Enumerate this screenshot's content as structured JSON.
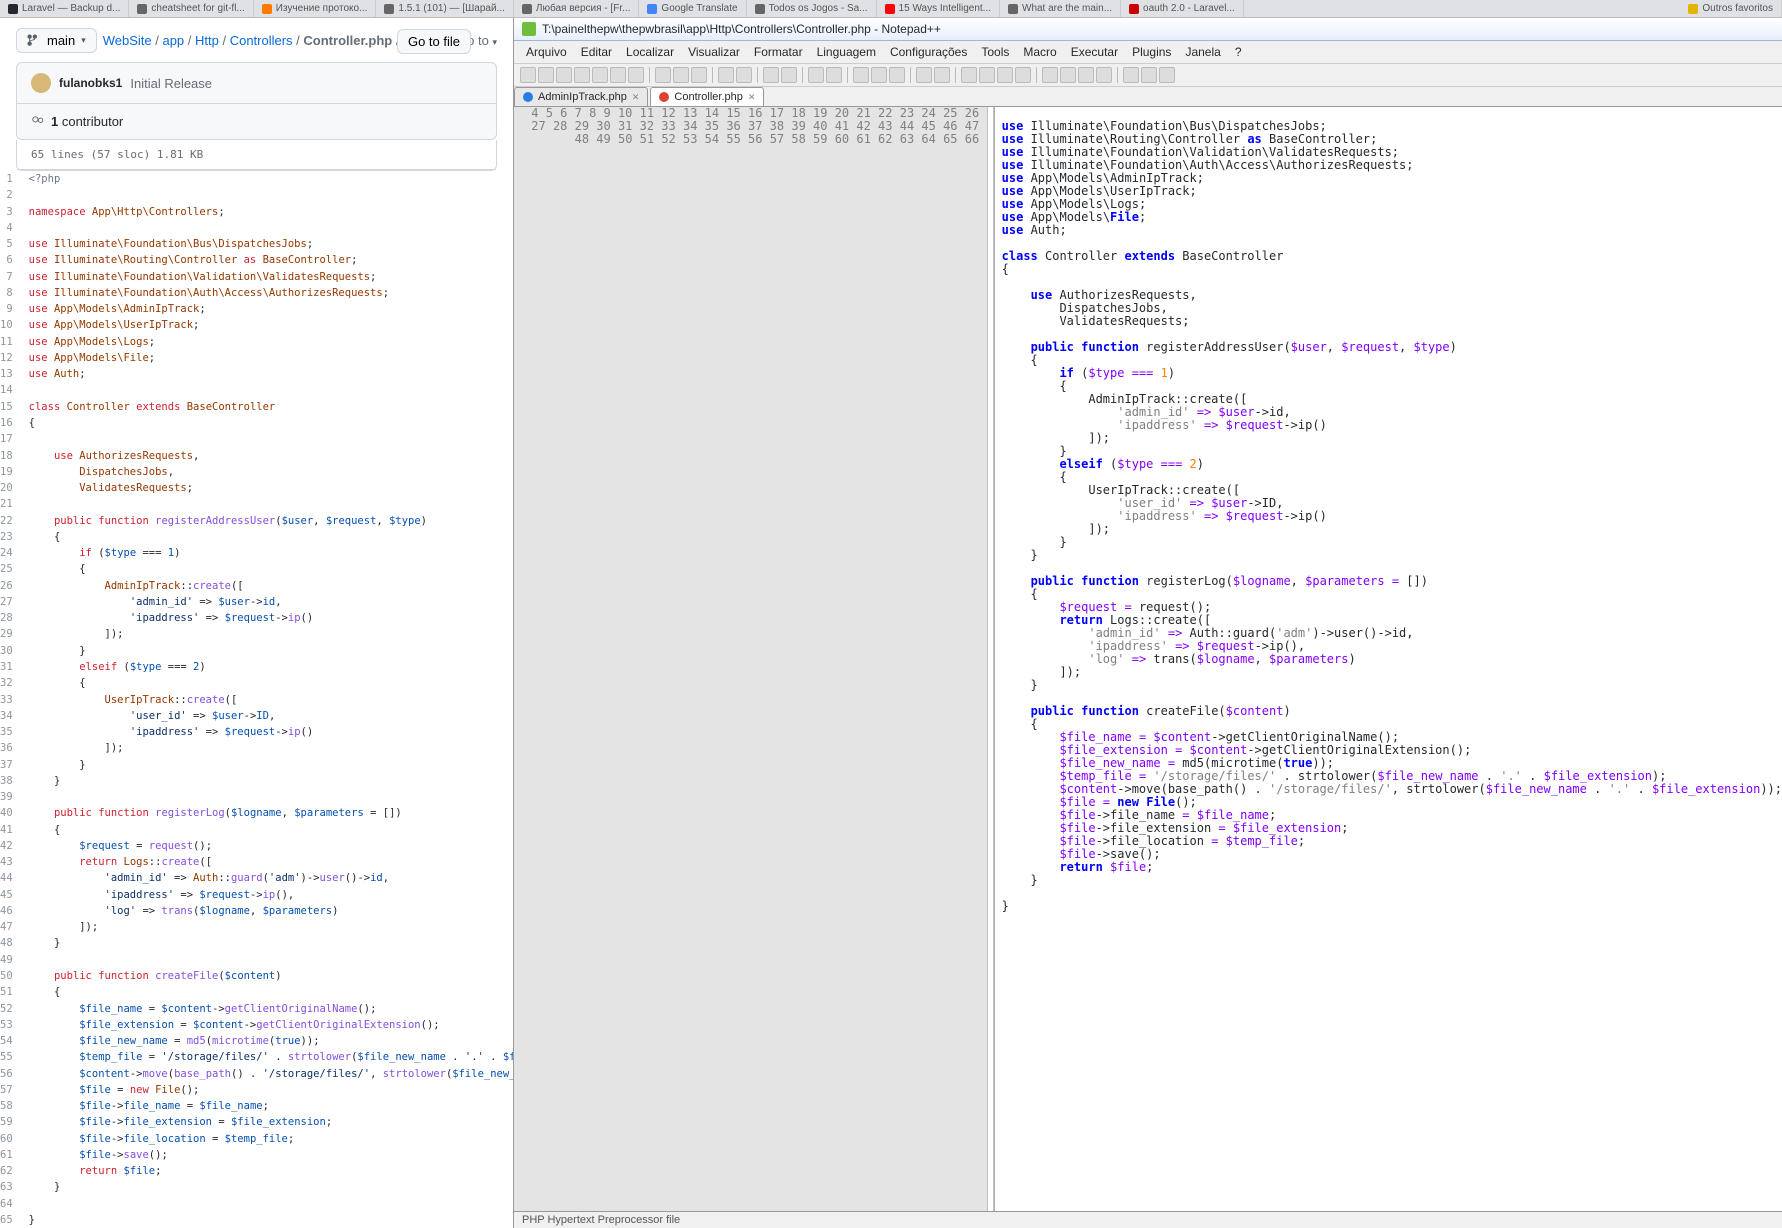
{
  "browserTabs": [
    {
      "icon": "gh",
      "label": "Laravel — Backup d..."
    },
    {
      "icon": "",
      "label": "cheatsheet for git-fl..."
    },
    {
      "icon": "or",
      "label": "Изучение протоко..."
    },
    {
      "icon": "",
      "label": "1.5.1 (101) — [Шарай..."
    },
    {
      "icon": "",
      "label": "Любая версия - [Fr..."
    },
    {
      "icon": "gt",
      "label": "Google Translate"
    },
    {
      "icon": "",
      "label": "Todos os Jogos - Sa..."
    },
    {
      "icon": "yt",
      "label": "15 Ways Intelligent..."
    },
    {
      "icon": "",
      "label": "What are the main..."
    },
    {
      "icon": "red",
      "label": "oauth 2.0 - Laravel..."
    }
  ],
  "favLabel": "Outros favoritos",
  "github": {
    "branchLabel": "main",
    "crumbs": [
      "WebSite",
      "app",
      "Http",
      "Controllers"
    ],
    "file": "Controller.php",
    "jump": "Jump to",
    "goto": "Go to file",
    "author": "fulanobks1",
    "commitMsg": "Initial Release",
    "contributors": "1 contributor",
    "fileMeta": "65 lines (57 sloc)   1.81 KB",
    "lines": [
      {
        "n": 1,
        "h": "<span class='c'>&lt;?php</span>"
      },
      {
        "n": 2,
        "h": ""
      },
      {
        "n": 3,
        "h": "<span class='k'>namespace</span> <span class='nn'>App\\Http\\Controllers</span>;"
      },
      {
        "n": 4,
        "h": ""
      },
      {
        "n": 5,
        "h": "<span class='k'>use</span> <span class='nn'>Illuminate\\Foundation\\Bus\\DispatchesJobs</span>;"
      },
      {
        "n": 6,
        "h": "<span class='k'>use</span> <span class='nn'>Illuminate\\Routing\\Controller</span> <span class='k'>as</span> <span class='nn'>BaseController</span>;"
      },
      {
        "n": 7,
        "h": "<span class='k'>use</span> <span class='nn'>Illuminate\\Foundation\\Validation\\ValidatesRequests</span>;"
      },
      {
        "n": 8,
        "h": "<span class='k'>use</span> <span class='nn'>Illuminate\\Foundation\\Auth\\Access\\AuthorizesRequests</span>;"
      },
      {
        "n": 9,
        "h": "<span class='k'>use</span> <span class='nn'>App\\Models\\AdminIpTrack</span>;"
      },
      {
        "n": 10,
        "h": "<span class='k'>use</span> <span class='nn'>App\\Models\\UserIpTrack</span>;"
      },
      {
        "n": 11,
        "h": "<span class='k'>use</span> <span class='nn'>App\\Models\\Logs</span>;"
      },
      {
        "n": 12,
        "h": "<span class='k'>use</span> <span class='nn'>App\\Models\\File</span>;"
      },
      {
        "n": 13,
        "h": "<span class='k'>use</span> <span class='nn'>Auth</span>;"
      },
      {
        "n": 14,
        "h": ""
      },
      {
        "n": 15,
        "h": "<span class='k'>class</span> <span class='nn'>Controller</span> <span class='k'>extends</span> <span class='nn'>BaseController</span>"
      },
      {
        "n": 16,
        "h": "{"
      },
      {
        "n": 17,
        "h": ""
      },
      {
        "n": 18,
        "h": "    <span class='k'>use</span> <span class='nn'>AuthorizesRequests</span>,"
      },
      {
        "n": 19,
        "h": "        <span class='nn'>DispatchesJobs</span>,"
      },
      {
        "n": 20,
        "h": "        <span class='nn'>ValidatesRequests</span>;"
      },
      {
        "n": 21,
        "h": ""
      },
      {
        "n": 22,
        "h": "    <span class='k'>public</span> <span class='k'>function</span> <span class='fn'>registerAddressUser</span>(<span class='v'>$user</span>, <span class='v'>$request</span>, <span class='v'>$type</span>)"
      },
      {
        "n": 23,
        "h": "    {"
      },
      {
        "n": 24,
        "h": "        <span class='k'>if</span> (<span class='v'>$type</span> === <span class='v'>1</span>)"
      },
      {
        "n": 25,
        "h": "        {"
      },
      {
        "n": 26,
        "h": "            <span class='nn'>AdminIpTrack</span>::<span class='fn'>create</span>(["
      },
      {
        "n": 27,
        "h": "                <span class='s'>'admin_id'</span> =&gt; <span class='v'>$user</span>-&gt;<span class='v'>id</span>,"
      },
      {
        "n": 28,
        "h": "                <span class='s'>'ipaddress'</span> =&gt; <span class='v'>$request</span>-&gt;<span class='fn'>ip</span>()"
      },
      {
        "n": 29,
        "h": "            ]);"
      },
      {
        "n": 30,
        "h": "        }"
      },
      {
        "n": 31,
        "h": "        <span class='k'>elseif</span> (<span class='v'>$type</span> === <span class='v'>2</span>)"
      },
      {
        "n": 32,
        "h": "        {"
      },
      {
        "n": 33,
        "h": "            <span class='nn'>UserIpTrack</span>::<span class='fn'>create</span>(["
      },
      {
        "n": 34,
        "h": "                <span class='s'>'user_id'</span> =&gt; <span class='v'>$user</span>-&gt;<span class='v'>ID</span>,"
      },
      {
        "n": 35,
        "h": "                <span class='s'>'ipaddress'</span> =&gt; <span class='v'>$request</span>-&gt;<span class='fn'>ip</span>()"
      },
      {
        "n": 36,
        "h": "            ]);"
      },
      {
        "n": 37,
        "h": "        }"
      },
      {
        "n": 38,
        "h": "    }"
      },
      {
        "n": 39,
        "h": ""
      },
      {
        "n": 40,
        "h": "    <span class='k'>public</span> <span class='k'>function</span> <span class='fn'>registerLog</span>(<span class='v'>$logname</span>, <span class='v'>$parameters</span> = [])"
      },
      {
        "n": 41,
        "h": "    {"
      },
      {
        "n": 42,
        "h": "        <span class='v'>$request</span> = <span class='fn'>request</span>();"
      },
      {
        "n": 43,
        "h": "        <span class='k'>return</span> <span class='nn'>Logs</span>::<span class='fn'>create</span>(["
      },
      {
        "n": 44,
        "h": "            <span class='s'>'admin_id'</span> =&gt; <span class='nn'>Auth</span>::<span class='fn'>guard</span>(<span class='s'>'adm'</span>)-&gt;<span class='fn'>user</span>()-&gt;<span class='v'>id</span>,"
      },
      {
        "n": 45,
        "h": "            <span class='s'>'ipaddress'</span> =&gt; <span class='v'>$request</span>-&gt;<span class='fn'>ip</span>(),"
      },
      {
        "n": 46,
        "h": "            <span class='s'>'log'</span> =&gt; <span class='fn'>trans</span>(<span class='v'>$logname</span>, <span class='v'>$parameters</span>)"
      },
      {
        "n": 47,
        "h": "        ]);"
      },
      {
        "n": 48,
        "h": "    }"
      },
      {
        "n": 49,
        "h": ""
      },
      {
        "n": 50,
        "h": "    <span class='k'>public</span> <span class='k'>function</span> <span class='fn'>createFile</span>(<span class='v'>$content</span>)"
      },
      {
        "n": 51,
        "h": "    {"
      },
      {
        "n": 52,
        "h": "        <span class='v'>$file_name</span> = <span class='v'>$content</span>-&gt;<span class='fn'>getClientOriginalName</span>();"
      },
      {
        "n": 53,
        "h": "        <span class='v'>$file_extension</span> = <span class='v'>$content</span>-&gt;<span class='fn'>getClientOriginalExtension</span>();"
      },
      {
        "n": 54,
        "h": "        <span class='v'>$file_new_name</span> = <span class='fn'>md5</span>(<span class='fn'>microtime</span>(<span class='v'>true</span>));"
      },
      {
        "n": 55,
        "h": "        <span class='v'>$temp_file</span> = <span class='s'>'/storage/files/'</span> . <span class='fn'>strtolower</span>(<span class='v'>$file_new_name</span> . <span class='s'>'.'</span> . <span class='v'>$file_extension</span>);"
      },
      {
        "n": 56,
        "h": "        <span class='v'>$content</span>-&gt;<span class='fn'>move</span>(<span class='fn'>base_path</span>() . <span class='s'>'/storage/files/'</span>, <span class='fn'>strtolower</span>(<span class='v'>$file_new_name</span> . <span class='s'>'.'</span> . <span class='v'>$file_extension</span>));"
      },
      {
        "n": 57,
        "h": "        <span class='v'>$file</span> = <span class='k'>new</span> <span class='nn'>File</span>();"
      },
      {
        "n": 58,
        "h": "        <span class='v'>$file</span>-&gt;<span class='v'>file_name</span> = <span class='v'>$file_name</span>;"
      },
      {
        "n": 59,
        "h": "        <span class='v'>$file</span>-&gt;<span class='v'>file_extension</span> = <span class='v'>$file_extension</span>;"
      },
      {
        "n": 60,
        "h": "        <span class='v'>$file</span>-&gt;<span class='v'>file_location</span> = <span class='v'>$temp_file</span>;"
      },
      {
        "n": 61,
        "h": "        <span class='v'>$file</span>-&gt;<span class='fn'>save</span>();"
      },
      {
        "n": 62,
        "h": "        <span class='k'>return</span> <span class='v'>$file</span>;"
      },
      {
        "n": 63,
        "h": "    }"
      },
      {
        "n": 64,
        "h": ""
      },
      {
        "n": 65,
        "h": "}"
      }
    ]
  },
  "npp": {
    "title": "T:\\painelthepw\\thepwbrasil\\app\\Http\\Controllers\\Controller.php - Notepad++",
    "menu": [
      "Arquivo",
      "Editar",
      "Localizar",
      "Visualizar",
      "Formatar",
      "Linguagem",
      "Configurações",
      "Tools",
      "Macro",
      "Executar",
      "Plugins",
      "Janela",
      "?"
    ],
    "tabs": [
      {
        "name": "AdminIpTrack.php",
        "dirty": false
      },
      {
        "name": "Controller.php",
        "dirty": true
      }
    ],
    "status": "PHP Hypertext Preprocessor file",
    "lines": [
      {
        "n": 4,
        "h": ""
      },
      {
        "n": 5,
        "h": "<span class='nk'>use</span> Illuminate\\Foundation\\Bus\\DispatchesJobs;"
      },
      {
        "n": 6,
        "h": "<span class='nk'>use</span> Illuminate\\Routing\\Controller <span class='nk'>as</span> BaseController;"
      },
      {
        "n": 7,
        "h": "<span class='nk'>use</span> Illuminate\\Foundation\\Validation\\ValidatesRequests;"
      },
      {
        "n": 8,
        "h": "<span class='nk'>use</span> Illuminate\\Foundation\\Auth\\Access\\AuthorizesRequests;"
      },
      {
        "n": 9,
        "h": "<span class='nk'>use</span> App\\Models\\AdminIpTrack;"
      },
      {
        "n": 10,
        "h": "<span class='nk'>use</span> App\\Models\\UserIpTrack;"
      },
      {
        "n": 11,
        "h": "<span class='nk'>use</span> App\\Models\\Logs;"
      },
      {
        "n": 12,
        "h": "<span class='nk'>use</span> App\\Models\\<span class='nk'>File</span>;"
      },
      {
        "n": 13,
        "h": "<span class='nk'>use</span> Auth;"
      },
      {
        "n": 14,
        "h": ""
      },
      {
        "n": 15,
        "h": "<span class='nk'>class</span> Controller <span class='nk'>extends</span> BaseController"
      },
      {
        "n": 16,
        "h": "{"
      },
      {
        "n": 17,
        "h": ""
      },
      {
        "n": 18,
        "h": "    <span class='nk'>use</span> AuthorizesRequests,"
      },
      {
        "n": 19,
        "h": "        DispatchesJobs,"
      },
      {
        "n": 20,
        "h": "        ValidatesRequests;"
      },
      {
        "n": 21,
        "h": ""
      },
      {
        "n": 22,
        "h": "    <span class='nk'>public</span> <span class='nk'>function</span> registerAddressUser(<span class='nt'>$user</span>, <span class='nt'>$request</span>, <span class='nt'>$type</span>)"
      },
      {
        "n": 23,
        "h": "    {"
      },
      {
        "n": 24,
        "h": "        <span class='nk'>if</span> (<span class='nt'>$type</span> <span class='nt'>===</span> <span class='nr'>1</span>)"
      },
      {
        "n": 25,
        "h": "        {"
      },
      {
        "n": 26,
        "h": "            AdminIpTrack::create(["
      },
      {
        "n": 27,
        "h": "                <span class='ns'>'admin_id'</span> <span class='nt'>=&gt;</span> <span class='nt'>$user</span>-&gt;id,"
      },
      {
        "n": 28,
        "h": "                <span class='ns'>'ipaddress'</span> <span class='nt'>=&gt;</span> <span class='nt'>$request</span>-&gt;ip()"
      },
      {
        "n": 29,
        "h": "            ]);"
      },
      {
        "n": 30,
        "h": "        }"
      },
      {
        "n": 31,
        "h": "        <span class='nk'>elseif</span> (<span class='nt'>$type</span> <span class='nt'>===</span> <span class='nr'>2</span>)"
      },
      {
        "n": 32,
        "h": "        {"
      },
      {
        "n": 33,
        "h": "            UserIpTrack::create(["
      },
      {
        "n": 34,
        "h": "                <span class='ns'>'user_id'</span> <span class='nt'>=&gt;</span> <span class='nt'>$user</span>-&gt;ID,"
      },
      {
        "n": 35,
        "h": "                <span class='ns'>'ipaddress'</span> <span class='nt'>=&gt;</span> <span class='nt'>$request</span>-&gt;ip()"
      },
      {
        "n": 36,
        "h": "            ]);"
      },
      {
        "n": 37,
        "h": "        }"
      },
      {
        "n": 38,
        "h": "    }"
      },
      {
        "n": 39,
        "h": ""
      },
      {
        "n": 40,
        "h": "    <span class='nk'>public</span> <span class='nk'>function</span> registerLog(<span class='nt'>$logname</span>, <span class='nt'>$parameters</span> <span class='nt'>=</span> [])"
      },
      {
        "n": 41,
        "h": "    {"
      },
      {
        "n": 42,
        "h": "        <span class='nt'>$request</span> <span class='nt'>=</span> request();"
      },
      {
        "n": 43,
        "h": "        <span class='nk'>return</span> Logs::create(["
      },
      {
        "n": 44,
        "h": "            <span class='ns'>'admin_id'</span> <span class='nt'>=&gt;</span> Auth::guard(<span class='ns'>'adm'</span>)-&gt;user()-&gt;id,"
      },
      {
        "n": 45,
        "h": "            <span class='ns'>'ipaddress'</span> <span class='nt'>=&gt;</span> <span class='nt'>$request</span>-&gt;ip(),"
      },
      {
        "n": 46,
        "h": "            <span class='ns'>'log'</span> <span class='nt'>=&gt;</span> trans(<span class='nt'>$logname</span>, <span class='nt'>$parameters</span>)"
      },
      {
        "n": 47,
        "h": "        ]);"
      },
      {
        "n": 48,
        "h": "    }"
      },
      {
        "n": 49,
        "h": ""
      },
      {
        "n": 50,
        "h": "    <span class='nk'>public</span> <span class='nk'>function</span> createFile(<span class='nt'>$content</span>)"
      },
      {
        "n": 51,
        "h": "    {"
      },
      {
        "n": 52,
        "h": "        <span class='nt'>$file_name</span> <span class='nt'>=</span> <span class='nt'>$content</span>-&gt;getClientOriginalName();"
      },
      {
        "n": 53,
        "h": "        <span class='nt'>$file_extension</span> <span class='nt'>=</span> <span class='nt'>$content</span>-&gt;getClientOriginalExtension();"
      },
      {
        "n": 54,
        "h": "        <span class='nt'>$file_new_name</span> <span class='nt'>=</span> md5(microtime(<span class='nk'>true</span>));"
      },
      {
        "n": 55,
        "h": "        <span class='nt'>$temp_file</span> <span class='nt'>=</span> <span class='ns'>'/storage/files/'</span> . strtolower(<span class='nt'>$file_new_name</span> . <span class='ns'>'.'</span> . <span class='nt'>$file_extension</span>);"
      },
      {
        "n": 56,
        "h": "        <span class='nt'>$content</span>-&gt;move(base_path() . <span class='ns'>'/storage/files/'</span>, strtolower(<span class='nt'>$file_new_name</span> . <span class='ns'>'.'</span> . <span class='nt'>$file_extension</span>));"
      },
      {
        "n": 57,
        "h": "        <span class='nt'>$file</span> <span class='nt'>=</span> <span class='nk'>new</span> <span class='nk'>File</span>();"
      },
      {
        "n": 58,
        "h": "        <span class='nt'>$file</span>-&gt;file_name <span class='nt'>=</span> <span class='nt'>$file_name</span>;"
      },
      {
        "n": 59,
        "h": "        <span class='nt'>$file</span>-&gt;file_extension <span class='nt'>=</span> <span class='nt'>$file_extension</span>;"
      },
      {
        "n": 60,
        "h": "        <span class='nt'>$file</span>-&gt;file_location <span class='nt'>=</span> <span class='nt'>$temp_file</span>;"
      },
      {
        "n": 61,
        "h": "        <span class='nt'>$file</span>-&gt;save();"
      },
      {
        "n": 62,
        "h": "        <span class='nk'>return</span> <span class='nt'>$file</span>;"
      },
      {
        "n": 63,
        "h": "    }"
      },
      {
        "n": 64,
        "h": ""
      },
      {
        "n": 65,
        "h": "}"
      },
      {
        "n": 66,
        "h": ""
      }
    ]
  }
}
